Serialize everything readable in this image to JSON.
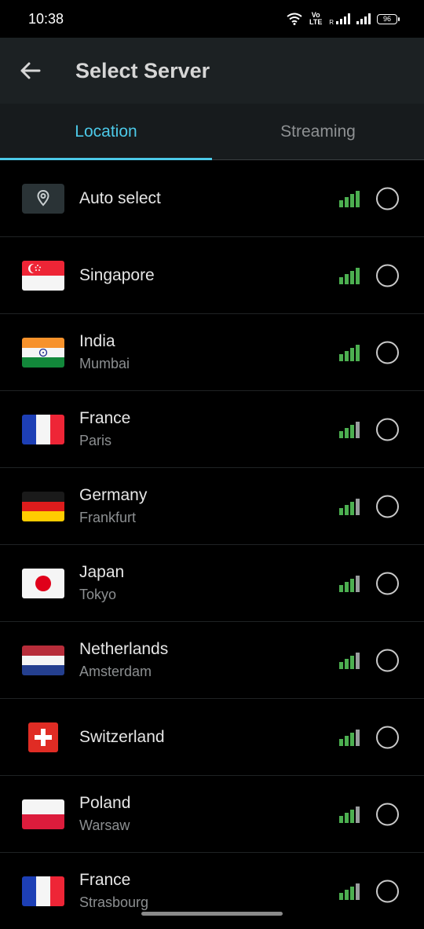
{
  "status": {
    "time": "10:38",
    "volte": "Vo LTE",
    "roaming": "R",
    "battery": "96"
  },
  "header": {
    "title": "Select Server"
  },
  "tabs": [
    {
      "label": "Location"
    },
    {
      "label": "Streaming"
    }
  ],
  "colors": {
    "accent": "#4cc9e8",
    "signal": "#4caf50",
    "app_bar": "#1c2123"
  },
  "servers": [
    {
      "name": "Auto select",
      "city": "",
      "icon": "location-pin-icon",
      "selected": false
    },
    {
      "name": "Singapore",
      "city": "",
      "icon": "singapore-flag",
      "selected": false
    },
    {
      "name": "India",
      "city": "Mumbai",
      "icon": "india-flag",
      "selected": false
    },
    {
      "name": "France",
      "city": "Paris",
      "icon": "france-flag",
      "selected": false
    },
    {
      "name": "Germany",
      "city": "Frankfurt",
      "icon": "germany-flag",
      "selected": false
    },
    {
      "name": "Japan",
      "city": "Tokyo",
      "icon": "japan-flag",
      "selected": false
    },
    {
      "name": "Netherlands",
      "city": "Amsterdam",
      "icon": "netherlands-flag",
      "selected": false
    },
    {
      "name": "Switzerland",
      "city": "",
      "icon": "switzerland-flag",
      "selected": false
    },
    {
      "name": "Poland",
      "city": "Warsaw",
      "icon": "poland-flag",
      "selected": false
    },
    {
      "name": "France",
      "city": "Strasbourg",
      "icon": "france-flag",
      "selected": false
    }
  ]
}
